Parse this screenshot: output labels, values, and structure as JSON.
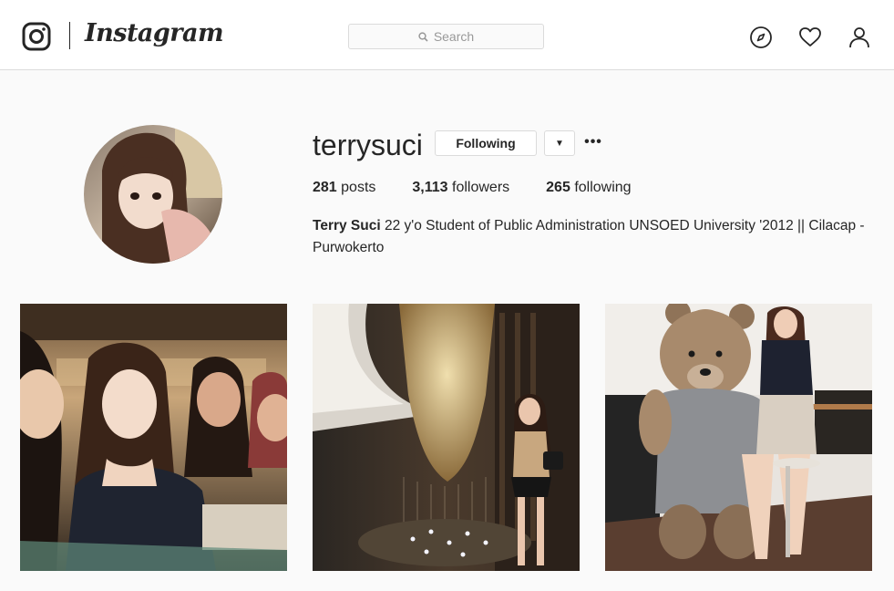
{
  "nav": {
    "wordmark": "Instagram",
    "search_placeholder": "Search",
    "icons": [
      "instagram-glyph-icon",
      "search-icon",
      "explore-compass-icon",
      "heart-icon",
      "profile-person-icon"
    ]
  },
  "profile": {
    "username": "terrysuci",
    "follow_label": "Following",
    "dropdown_glyph": "▼",
    "more_glyph": "•••",
    "stats": [
      {
        "value": "281",
        "label": "posts"
      },
      {
        "value": "3,113",
        "label": "followers"
      },
      {
        "value": "265",
        "label": "following"
      }
    ],
    "bio_name": "Terry Suci",
    "bio_text": "22 y'o Student of Public Administration UNSOED University '2012 || Cilacap - Purwokerto"
  },
  "posts": [
    {
      "name": "post-photo-friends-group"
    },
    {
      "name": "post-photo-chandelier"
    },
    {
      "name": "post-photo-teddy-bear"
    }
  ],
  "colors": {
    "text": "#262626",
    "border": "#dbdbdb",
    "background": "#fafafa",
    "muted": "#999999"
  }
}
